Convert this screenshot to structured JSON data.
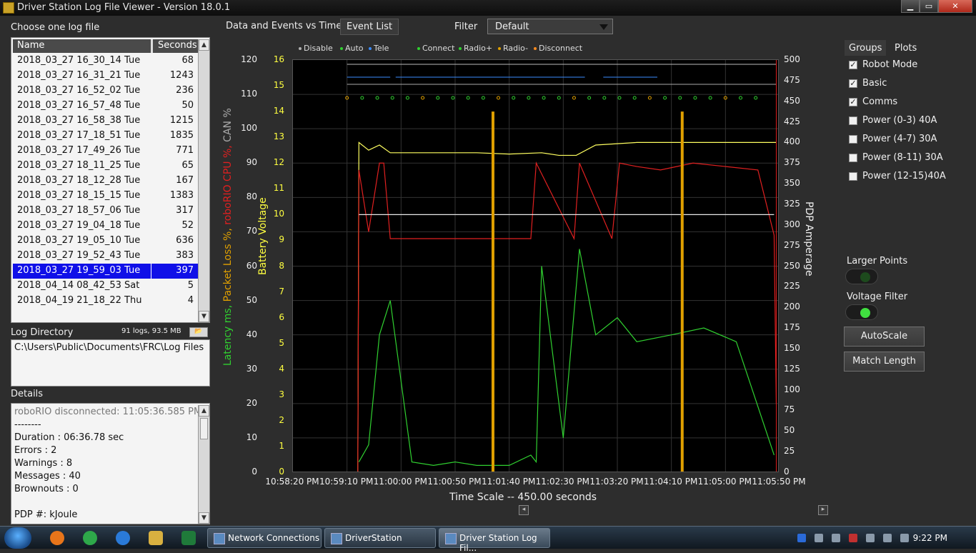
{
  "window": {
    "title": "Driver Station Log File Viewer - Version 18.0.1",
    "minimize": "▁",
    "maximize": "▭",
    "close": "✕"
  },
  "left": {
    "choose_label": "Choose one log file",
    "columns": [
      "Name",
      "Seconds"
    ],
    "files": [
      {
        "name": "2018_03_27 16_30_14 Tue",
        "seconds": "68"
      },
      {
        "name": "2018_03_27 16_31_21 Tue",
        "seconds": "1243"
      },
      {
        "name": "2018_03_27 16_52_02 Tue",
        "seconds": "236"
      },
      {
        "name": "2018_03_27 16_57_48 Tue",
        "seconds": "50"
      },
      {
        "name": "2018_03_27 16_58_38 Tue",
        "seconds": "1215"
      },
      {
        "name": "2018_03_27 17_18_51 Tue",
        "seconds": "1835"
      },
      {
        "name": "2018_03_27 17_49_26 Tue",
        "seconds": "771"
      },
      {
        "name": "2018_03_27 18_11_25 Tue",
        "seconds": "65"
      },
      {
        "name": "2018_03_27 18_12_28 Tue",
        "seconds": "167"
      },
      {
        "name": "2018_03_27 18_15_15 Tue",
        "seconds": "1383"
      },
      {
        "name": "2018_03_27 18_57_06 Tue",
        "seconds": "317"
      },
      {
        "name": "2018_03_27 19_04_18 Tue",
        "seconds": "52"
      },
      {
        "name": "2018_03_27 19_05_10 Tue",
        "seconds": "636"
      },
      {
        "name": "2018_03_27 19_52_43 Tue",
        "seconds": "383"
      },
      {
        "name": "2018_03_27 19_59_03 Tue",
        "seconds": "397",
        "selected": true
      },
      {
        "name": "2018_04_14 08_42_53 Sat",
        "seconds": "5"
      },
      {
        "name": "2018_04_19 21_18_22 Thu",
        "seconds": "4"
      }
    ],
    "log_dir_label": "Log Directory",
    "log_stats": "91 logs, 93.5 MB",
    "log_dir_path": "C:\\Users\\Public\\Documents\\FRC\\Log Files",
    "details_label": "Details",
    "details": [
      "roboRIO disconnected:  11:05:36.585 PM",
      "--------",
      "Duration : 06:36.78 sec",
      "Errors : 2",
      "Warnings : 8",
      "Messages : 40",
      "Brownouts : 0",
      "",
      "PDP #:   kJoule"
    ]
  },
  "tabs": {
    "data_events": "Data and Events vs Time",
    "event_list": "Event List",
    "filter_label": "Filter",
    "filter_value": "Default"
  },
  "legend": [
    {
      "label": "Disable",
      "color": "#b0b0b0"
    },
    {
      "label": "Auto",
      "color": "#30d030"
    },
    {
      "label": "Tele",
      "color": "#3a8cff"
    },
    {
      "label": "Connect",
      "color": "#30d030"
    },
    {
      "label": "Radio+",
      "color": "#30d030"
    },
    {
      "label": "Radio-",
      "color": "#e0a000"
    },
    {
      "label": "Disconnect",
      "color": "#ff8c20"
    }
  ],
  "axes": {
    "left_outer_title": "Latency ms, Packet Loss %,  roboRIO CPU %,  CAN %",
    "left_outer_ticks": [
      "120",
      "110",
      "100",
      "90",
      "80",
      "70",
      "60",
      "50",
      "40",
      "30",
      "20",
      "10",
      "0"
    ],
    "left_inner_title": "Battery Voltage",
    "left_inner_ticks": [
      "16",
      "15",
      "14",
      "13",
      "12",
      "11",
      "10",
      "9",
      "8",
      "7",
      "6",
      "5",
      "4",
      "3",
      "2",
      "1",
      "0"
    ],
    "right_title": "PDP Amperage",
    "right_ticks": [
      "500",
      "475",
      "450",
      "425",
      "400",
      "375",
      "350",
      "325",
      "300",
      "275",
      "250",
      "225",
      "200",
      "175",
      "150",
      "125",
      "100",
      "75",
      "50",
      "25",
      "0"
    ],
    "x_ticks": [
      "10:58:20 PM",
      "10:59:10 PM",
      "11:00:00 PM",
      "11:00:50 PM",
      "11:01:40 PM",
      "11:02:30 PM",
      "11:03:20 PM",
      "11:04:10 PM",
      "11:05:00 PM",
      "11:05:50 PM"
    ],
    "time_scale": "Time Scale -- 450.00 seconds"
  },
  "chart_data": {
    "type": "line",
    "title": "",
    "xlabel": "Time Scale -- 450.00 seconds",
    "x_range": [
      "10:58:20 PM",
      "11:05:50 PM"
    ],
    "ylabel_left": "Latency ms, Packet Loss %,  roboRIO CPU %,  CAN %",
    "ylim_left": [
      0,
      120
    ],
    "ylabel_voltage": "Battery Voltage",
    "ylim_voltage": [
      0,
      16
    ],
    "ylabel_right": "PDP Amperage",
    "ylim_right": [
      0,
      500
    ],
    "grid": true,
    "series": [
      {
        "name": "Battery Voltage",
        "color": "#ffff60",
        "x_s": [
          0,
          10,
          11,
          20,
          30,
          40,
          60,
          120,
          150,
          180,
          196,
          212,
          230,
          268,
          278,
          290,
          300,
          397
        ],
        "y": [
          0,
          0,
          12.8,
          12.5,
          12.7,
          12.4,
          12.4,
          12.4,
          12.35,
          12.4,
          12.3,
          12.3,
          12.7,
          12.8,
          12.8,
          12.8,
          12.8,
          12.8
        ]
      },
      {
        "name": "roboRIO CPU %",
        "color": "#e02020",
        "x_s": [
          0,
          10,
          11,
          20,
          30,
          34,
          40,
          170,
          175,
          210,
          215,
          245,
          252,
          268,
          290,
          320,
          350,
          380,
          395,
          397
        ],
        "y": [
          0,
          0,
          88,
          70,
          90,
          90,
          68,
          68,
          90,
          68,
          90,
          68,
          90,
          89,
          88,
          90,
          89,
          88,
          69,
          20
        ]
      },
      {
        "name": "CAN %",
        "color": "#e8e8e8",
        "x_s": [
          11,
          100,
          200,
          300,
          395
        ],
        "y": [
          75,
          75,
          75,
          75,
          75
        ]
      },
      {
        "name": "Latency ms",
        "color": "#30d030",
        "x_s": [
          11,
          20,
          30,
          40,
          60,
          80,
          100,
          120,
          150,
          170,
          175,
          180,
          200,
          215,
          230,
          250,
          268,
          300,
          330,
          360,
          395
        ],
        "y": [
          3,
          8,
          40,
          50,
          3,
          2,
          3,
          2,
          2,
          5,
          3,
          60,
          10,
          65,
          40,
          45,
          38,
          40,
          42,
          38,
          5
        ]
      },
      {
        "name": "Packet Loss %",
        "color": "#e0a000",
        "type": "bar",
        "x_s": [
          135,
          310
        ],
        "y": [
          105,
          105
        ]
      }
    ]
  },
  "right": {
    "tab_groups": "Groups",
    "tab_plots": "Plots",
    "groups": [
      {
        "label": "Robot Mode",
        "checked": true
      },
      {
        "label": "Basic",
        "checked": true
      },
      {
        "label": "Comms",
        "checked": true
      },
      {
        "label": "Power (0-3) 40A",
        "checked": false
      },
      {
        "label": "Power (4-7) 30A",
        "checked": false
      },
      {
        "label": "Power (8-11) 30A",
        "checked": false
      },
      {
        "label": "Power (12-15)40A",
        "checked": false
      }
    ],
    "larger_points_label": "Larger Points",
    "voltage_filter_label": "Voltage Filter",
    "autoscale": "AutoScale",
    "match_length": "Match Length"
  },
  "taskbar": {
    "tasks": [
      "Network Connections",
      "DriverStation",
      "Driver Station Log Fil..."
    ],
    "clock": "9:22 PM"
  }
}
